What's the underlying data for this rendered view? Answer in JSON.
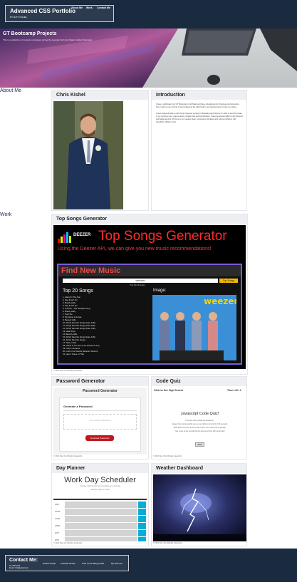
{
  "header": {
    "title": "Advanced CSS Portfolio",
    "subtitle": "BY MATT KISHEL",
    "nav": [
      "About Me",
      "Work",
      "Contact Me"
    ]
  },
  "hero": {
    "title": "GT Bootcamp Projects",
    "subtitle": "This is a collection of projects completed during the Georgia Tech Full Stack Coding Bootcamp"
  },
  "about": {
    "section_label": "About Me",
    "profile_title": "Chris Kishel",
    "intro_title": "Introduction",
    "intro_paragraphs": [
      "I have a certificate from GT Bootcamp's Full Stack and have a background in Finance and Accounting. Now I want to use a blend of accounting and the skills built in web development to bring my values.",
      "I have analyzed data on both fronts however working in Marketing and Finance I'm able to combine ideas. In my previous role I used a variety of data tools and technologies. I have developed skills in both frontend and backend work. My focus is on creating clean, responsive interfaces and solving problems with thoughtful, efficient code."
    ]
  },
  "work": {
    "section_label": "Work",
    "top_songs": {
      "title": "Top Songs Generator",
      "banner_brand": "DEEZER",
      "banner_heading": "Top Songs Generator",
      "banner_tagline": "Using the Deezer API, we can give you new music recommendations!",
      "find_heading": "Find New Music",
      "search_value": "weezer",
      "search_button": "Top Songs",
      "search_hint": "Your Top 20 Songs:",
      "list_heading": "Top 20 Songs",
      "image_heading": "Image:",
      "album_word": "weezer",
      "songs": [
        "1. Island In The Sun",
        "2. Say It Ain't So",
        "3. Buddy Holly",
        "4. Say It Ain't So",
        "5. Undone - The Sweater Song",
        "6. Buddy Holly",
        "7. Pork Pie",
        "8. My Name Is Jonas",
        "9. Beverly Hills",
        "10. All My Favorite Songs (feat. AJR)",
        "11. All My Favorite Songs (feat. AJR)",
        "12. All My Favorite Songs (feat. AJR)",
        "13. Hash Pipe",
        "14. Beverly Hills",
        "15. All My Favorite Songs (feat. AJR)",
        "16. All My Favorite Songs",
        "17. Take on Me",
        "18. Island In The Sun (Live Hands of Yes)",
        "19. Only In Dreams",
        "20. Lost in the Woods (Weezer Version)",
        "21. Hero / Some of That"
      ],
      "caption": "© 2021 Site. Not Working Javascript"
    },
    "password": {
      "title": "Password Generator",
      "app_title": "Password Generator",
      "subhead": "Generate a Password",
      "placeholder": "Your Secure Password",
      "button": "Generate Password",
      "caption": "© 2021 Site. Not Working Javascript"
    },
    "quiz": {
      "title": "Code Quiz",
      "high_scores": "Click to See High Scores",
      "time_left": "Time Left: 0",
      "heading": "Javascript Code Quiz!",
      "lines": [
        "Here are some javascript questions.",
        "Answer them all as quickly as you can within a time limit of 60 seconds.",
        "Wait! Each incorrect answer will result in a 10 second time penalty.",
        "Your score at the end will be the amount of time left! Good luck!"
      ],
      "start": "Start",
      "caption": "© 2021 Site. Not Working Javascript"
    },
    "planner": {
      "title": "Day Planner",
      "app_title": "Work Day Scheduler",
      "app_sub": "A simple calendar app for scheduling your work day",
      "app_date": "Saturday, May 1st, 2021",
      "hours": [
        "9AM",
        "10AM",
        "11AM",
        "12PM",
        "1PM",
        "2PM"
      ],
      "caption": "© 2021 Site. Not Working Javascript"
    },
    "weather": {
      "title": "Weather Dashboard",
      "caption": "© 2021 Site. Not Working Javascript"
    }
  },
  "footer": {
    "title": "Contact Me:",
    "lines": [
      "Tel: 555-1234",
      "Email: chris@gmail.com"
    ],
    "links": [
      "Github Profile",
      "LinkedIn Profile",
      "Free Lunch Blog Profile",
      "My Resume"
    ]
  },
  "colors": {
    "header_bg": "#1a2a3f",
    "brand_box": "#2c3b50",
    "accent_button": "#c0161e",
    "weezer_blue": "#3b8fd6"
  }
}
